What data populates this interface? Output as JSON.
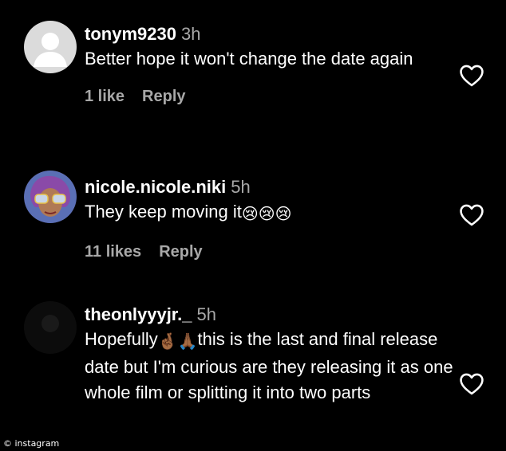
{
  "comments": [
    {
      "username": "tonym9230",
      "time": "3h",
      "text": "Better hope it won't change the date again",
      "likes": "1 like",
      "reply": "Reply",
      "avatar_icon": "default-profile-icon"
    },
    {
      "username": "nicole.nicole.niki",
      "time": "5h",
      "text": "They keep moving it",
      "emojis": "😢😢😢",
      "likes": "11 likes",
      "reply": "Reply",
      "avatar_icon": "profile-photo"
    },
    {
      "username": "theonlyyyjr._",
      "time": "5h",
      "text_before": "Hopefully",
      "emojis": "🤞🏾🙏🏾",
      "text_after": "this is the last and final release date but I'm curious are they releasing it as one whole film or splitting it into two parts",
      "avatar_icon": "profile-photo"
    }
  ],
  "watermark": "© instagram",
  "colors": {
    "background": "#000000",
    "text": "#ffffff",
    "muted": "#a8a8a8"
  }
}
